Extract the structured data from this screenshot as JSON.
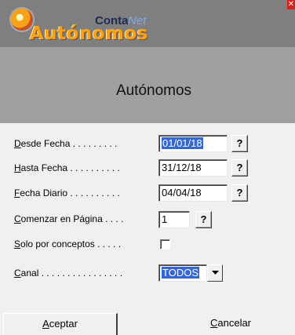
{
  "brand": {
    "conta": "Conta",
    "net": "Net",
    "product": "Autónomos"
  },
  "window": {
    "title": "Autónomos",
    "close_glyph": "✕"
  },
  "form": {
    "desde_fecha": {
      "label_hotkey": "D",
      "label_rest": "esde Fecha . . . . . . . . .",
      "value": "01/01/18",
      "button": "?"
    },
    "hasta_fecha": {
      "label_hotkey": "H",
      "label_rest": "asta Fecha . . . . . . . . . .",
      "value": "31/12/18",
      "button": "?"
    },
    "fecha_diario": {
      "label_hotkey": "F",
      "label_rest": "echa Diario . . . . . . . . . .",
      "value": "04/04/18",
      "button": "?"
    },
    "comenzar_pagina": {
      "label_hotkey": "C",
      "label_rest": "omenzar en Página . . . .",
      "value": "1",
      "button": "?"
    },
    "solo_conceptos": {
      "label_hotkey": "S",
      "label_rest": "olo por conceptos . . . . .",
      "checked": false
    },
    "canal": {
      "label_hotkey": "C",
      "label_rest": "anal . . . . . . . . . . . . . . . .",
      "value": "TODOS"
    }
  },
  "buttons": {
    "accept_hotkey": "A",
    "accept_rest": "ceptar",
    "cancel_hotkey": "C",
    "cancel_rest": "ancelar"
  },
  "colors": {
    "selection": "#3367d6",
    "header_band": "#7f7f7f",
    "title_area": "#a0a0a0",
    "brand_orange": "#f4a31b"
  }
}
